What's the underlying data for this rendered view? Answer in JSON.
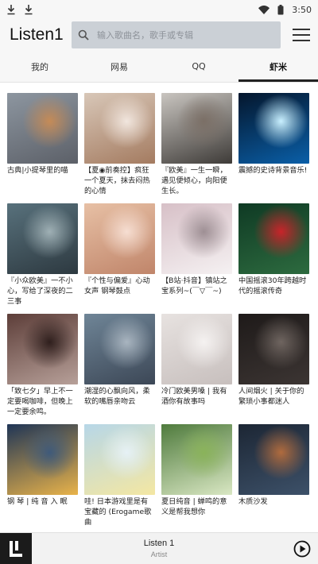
{
  "status": {
    "time": "3:50"
  },
  "app": {
    "title": "Listen1"
  },
  "search": {
    "placeholder": "输入歌曲名，歌手或专辑"
  },
  "tabs": [
    {
      "label": "我的",
      "active": false
    },
    {
      "label": "网易",
      "active": false
    },
    {
      "label": "QQ",
      "active": false
    },
    {
      "label": "虾米",
      "active": true
    }
  ],
  "playlists": [
    {
      "title": "古典|小提琴里的喵",
      "palette": [
        "#8d96a0",
        "#5c6068",
        "#c58b57"
      ]
    },
    {
      "title": "【夏◉前奏控】疯狂一个夏天，抹去闷热的心情",
      "palette": [
        "#d8c7b8",
        "#a47b60",
        "#f1e6de"
      ]
    },
    {
      "title": "『欧美』一生一瞬，遇见便倾心，向阳便生长。",
      "palette": [
        "#c9c5c0",
        "#3e3b38",
        "#7b6f66"
      ]
    },
    {
      "title": "震撼的史诗背景音乐!",
      "palette": [
        "#04162c",
        "#0a5fa8",
        "#c9f0ff"
      ]
    },
    {
      "title": "『小众欧美』一不小心，写给了深夜的二三事",
      "palette": [
        "#58717c",
        "#2d3940",
        "#9fb0b5"
      ]
    },
    {
      "title": "『个性与偏爱』心动女声 钢琴鼓点",
      "palette": [
        "#e7c0a5",
        "#c0856a",
        "#f6ded2"
      ]
    },
    {
      "title": "【B站·抖音】镇站之宝系列~(￣▽￣~)",
      "palette": [
        "#d7c0c7",
        "#f5f1f2",
        "#9e8f94"
      ]
    },
    {
      "title": "中国摇滚30年跨越时代的摇滚传奇",
      "palette": [
        "#0f3a24",
        "#2d6b3f",
        "#c8242a"
      ]
    },
    {
      "title": "「致七夕」早上不一定要喝咖啡，但晚上一定要余鸣。",
      "palette": [
        "#5d3e39",
        "#b7a099",
        "#2f1f1d"
      ]
    },
    {
      "title": "潮湿的心飘向风，柔软的嘴唇亲吻云",
      "palette": [
        "#6f8597",
        "#3c4756",
        "#a9b5c0"
      ]
    },
    {
      "title": "冷门欧美男嗓 | 我有酒你有故事吗",
      "palette": [
        "#e7e2e0",
        "#c7bfbd",
        "#f5f2f1"
      ]
    },
    {
      "title": "人间烟火 | 关于你的繁琐小事都迷人",
      "palette": [
        "#1e1a19",
        "#3c3533",
        "#6f6560"
      ]
    },
    {
      "title": "钢 琴 | 纯 音 入 眠",
      "palette": [
        "#1f3556",
        "#e9b34a",
        "#3f5a7a"
      ]
    },
    {
      "title": "哇! 日本游戏里是有宝藏的 (Erogame歌曲",
      "palette": [
        "#b7d7e8",
        "#f4e7a2",
        "#e6f1f6"
      ]
    },
    {
      "title": "夏日纯音 | 蝉鸣的意义是帮我想你",
      "palette": [
        "#4f7b3d",
        "#d9e7c3",
        "#8ab35a"
      ]
    },
    {
      "title": "木质沙发",
      "palette": [
        "#1c2634",
        "#3d5169",
        "#b06b3e"
      ]
    }
  ],
  "player": {
    "title": "Listen 1",
    "artist": "Artist"
  }
}
